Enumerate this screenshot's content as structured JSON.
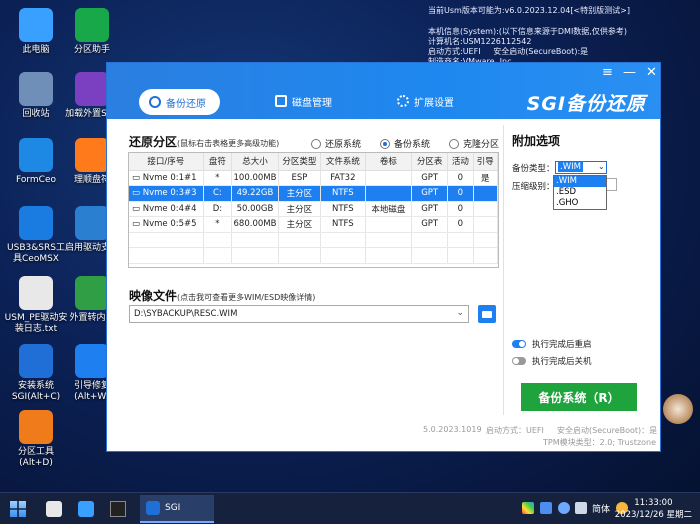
{
  "desktop": {
    "icons": [
      {
        "label": "此电脑",
        "icon": "computer-icon",
        "color": "#3aa0ff"
      },
      {
        "label": "分区助手",
        "icon": "partition-assistant-icon",
        "color": "#18a84a"
      },
      {
        "label": "回收站",
        "icon": "recycle-bin-icon",
        "color": "#6f8fb8"
      },
      {
        "label": "加载外置SRS",
        "icon": "load-srs-icon",
        "color": "#7b3fc2"
      },
      {
        "label": "FormCeo",
        "icon": "formceo-icon",
        "color": "#1e88e5"
      },
      {
        "label": "理顺盘符",
        "icon": "drive-letter-icon",
        "color": "#ff7a1a"
      },
      {
        "label": "USB3&SRS工具CeoMSX",
        "icon": "usb-tool-icon",
        "color": "#1a7be0"
      },
      {
        "label": "启用驱动支持",
        "icon": "driver-support-icon",
        "color": "#2b7fd0"
      },
      {
        "label": "USM_PE驱动安装日志.txt",
        "icon": "text-file-icon",
        "color": "#e8e8e8"
      },
      {
        "label": "外置转内置",
        "icon": "convert-icon",
        "color": "#2f9e44"
      },
      {
        "label": "安装系统SGI(Alt+C)",
        "icon": "sgi-icon",
        "color": "#1f6fd6"
      },
      {
        "label": "引导修复(Alt+W)",
        "icon": "boot-repair-icon",
        "color": "#1e7ff0"
      },
      {
        "label": "分区工具(Alt+D)",
        "icon": "partition-tool-icon",
        "color": "#f07b1a"
      }
    ],
    "sysinfo": "当前Usm版本可能为:v6.0.2023.12.04[<特别版测试>]\n\n本机信息(System):(以下信息来源于DMI数据,仅供参考)\n计算机名:USM1226112542\n启动方式:UEFI     安全启动(SecureBoot):是\n制造商名:VMware, Inc\n产品名称:VMware7,1"
  },
  "window": {
    "tabs": [
      {
        "label": "备份还原",
        "active": true
      },
      {
        "label": "磁盘管理",
        "active": false
      },
      {
        "label": "扩展设置",
        "active": false
      }
    ],
    "brand": "SGI备份还原",
    "controls": {
      "menu": "≡",
      "minimize": "—",
      "close": "✕"
    },
    "restore": {
      "title": "还原分区",
      "hint": "(鼠标右击表格更多高级功能)",
      "modes": [
        {
          "label": "还原系统",
          "selected": false
        },
        {
          "label": "备份系统",
          "selected": true
        },
        {
          "label": "克隆分区",
          "selected": false
        }
      ],
      "columns": [
        "接口/序号",
        "盘符",
        "总大小",
        "分区类型",
        "文件系统",
        "卷标",
        "分区表",
        "活动",
        "引导"
      ],
      "rows": [
        {
          "iface": "Nvme",
          "idx": "0:1#1",
          "letter": "*",
          "size": "100.00MB",
          "ptype": "ESP",
          "fs": "FAT32",
          "label": "",
          "table": "GPT",
          "active": "0",
          "boot": "是",
          "selected": false
        },
        {
          "iface": "Nvme",
          "idx": "0:3#3",
          "letter": "C:",
          "size": "49.22GB",
          "ptype": "主分区",
          "fs": "NTFS",
          "label": "",
          "table": "GPT",
          "active": "0",
          "boot": "",
          "selected": true
        },
        {
          "iface": "Nvme",
          "idx": "0:4#4",
          "letter": "D:",
          "size": "50.00GB",
          "ptype": "主分区",
          "fs": "NTFS",
          "label": "本地磁盘",
          "table": "GPT",
          "active": "0",
          "boot": "",
          "selected": false
        },
        {
          "iface": "Nvme",
          "idx": "0:5#5",
          "letter": "*",
          "size": "680.00MB",
          "ptype": "主分区",
          "fs": "NTFS",
          "label": "",
          "table": "GPT",
          "active": "0",
          "boot": "",
          "selected": false
        }
      ]
    },
    "image": {
      "title": "映像文件",
      "hint": "(点击我可查看更多WIM/ESD映像详情)",
      "path": "D:\\SYBACKUP\\RESC.WIM"
    },
    "options": {
      "title": "附加选项",
      "backup_type_label": "备份类型：",
      "backup_type_value": ".WIM",
      "backup_type_options": [
        ".WIM",
        ".ESD",
        ".GHO"
      ],
      "compress_label": "压缩级别：",
      "reboot_label": "执行完成后重启",
      "reboot_on": true,
      "shutdown_label": "执行完成后关机",
      "shutdown_on": false,
      "go_button": "备份系统（R）"
    },
    "footer": {
      "version": "5.0.2023.1019",
      "boot_mode": "启动方式：UEFI",
      "secure_boot": "安全启动(SecureBoot)：是",
      "tpm": "TPM模块类型：2.0; Trustzone"
    }
  },
  "taskbar": {
    "app_label": "SGI",
    "lang": "简体",
    "time": "11:33:00",
    "date": "2023/12/26 星期二"
  },
  "colors": {
    "accent": "#1e7ff0",
    "go_button": "#1fa33c",
    "header": "#2b7fe0"
  }
}
